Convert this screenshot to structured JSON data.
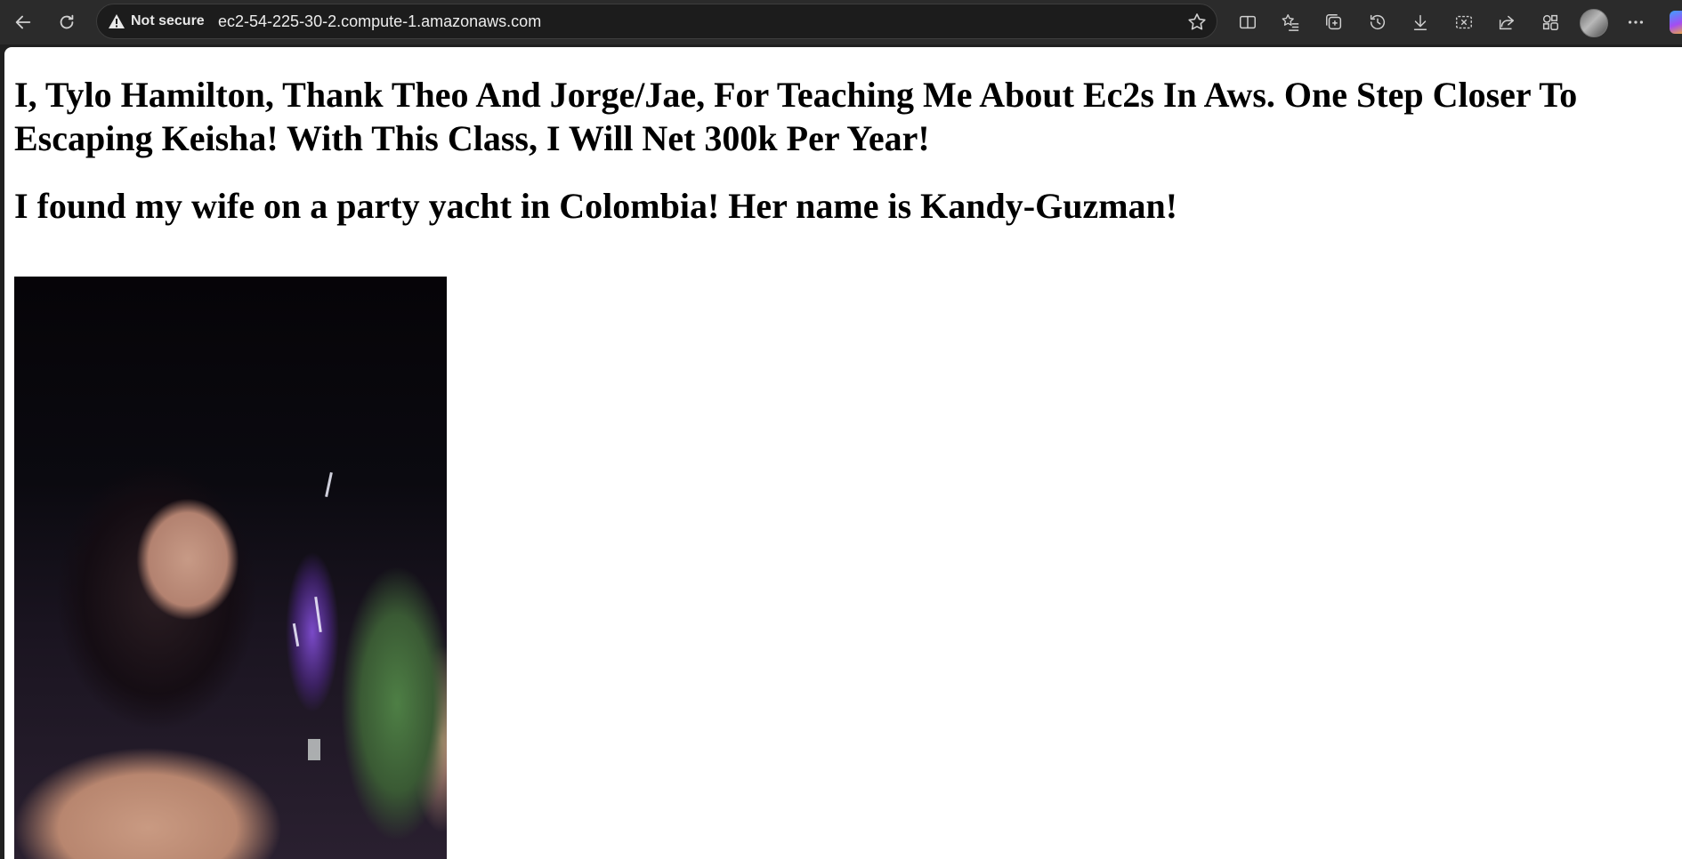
{
  "browser": {
    "security_label": "Not secure",
    "url": "ec2-54-225-30-2.compute-1.amazonaws.com"
  },
  "page": {
    "heading_1": "I, Tylo Hamilton, Thank Theo And Jorge/Jae, For Teaching Me About Ec2s In Aws. One Step Closer To Escaping Keisha! With This Class, I Will Net 300k Per Year!",
    "heading_2": "I found my wife on a party yacht in Colombia! Her name is Kandy-Guzman!"
  }
}
